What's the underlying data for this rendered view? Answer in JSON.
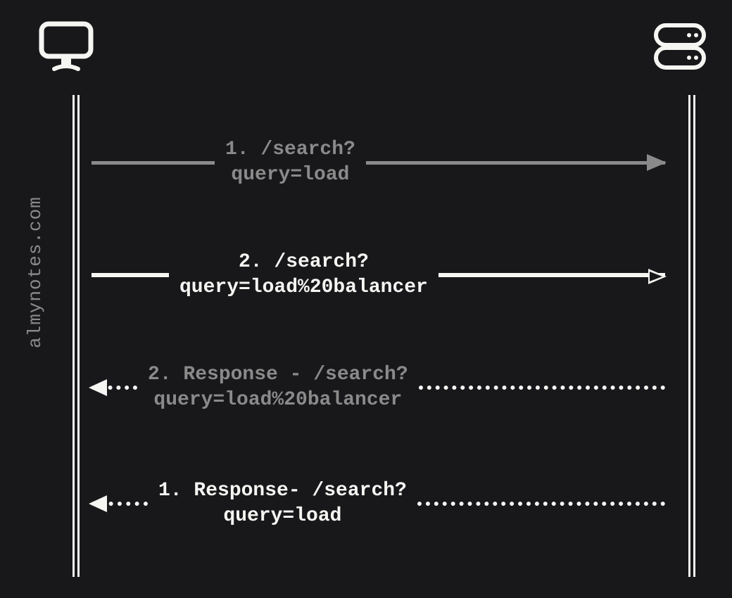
{
  "watermark": "almynotes.com",
  "messages": {
    "request1": "1. /search?\nquery=load",
    "request2": "2. /search?\nquery=load%20balancer",
    "response2": "2. Response - /search?\nquery=load%20balancer",
    "response1": "1. Response- /search?\nquery=load"
  }
}
